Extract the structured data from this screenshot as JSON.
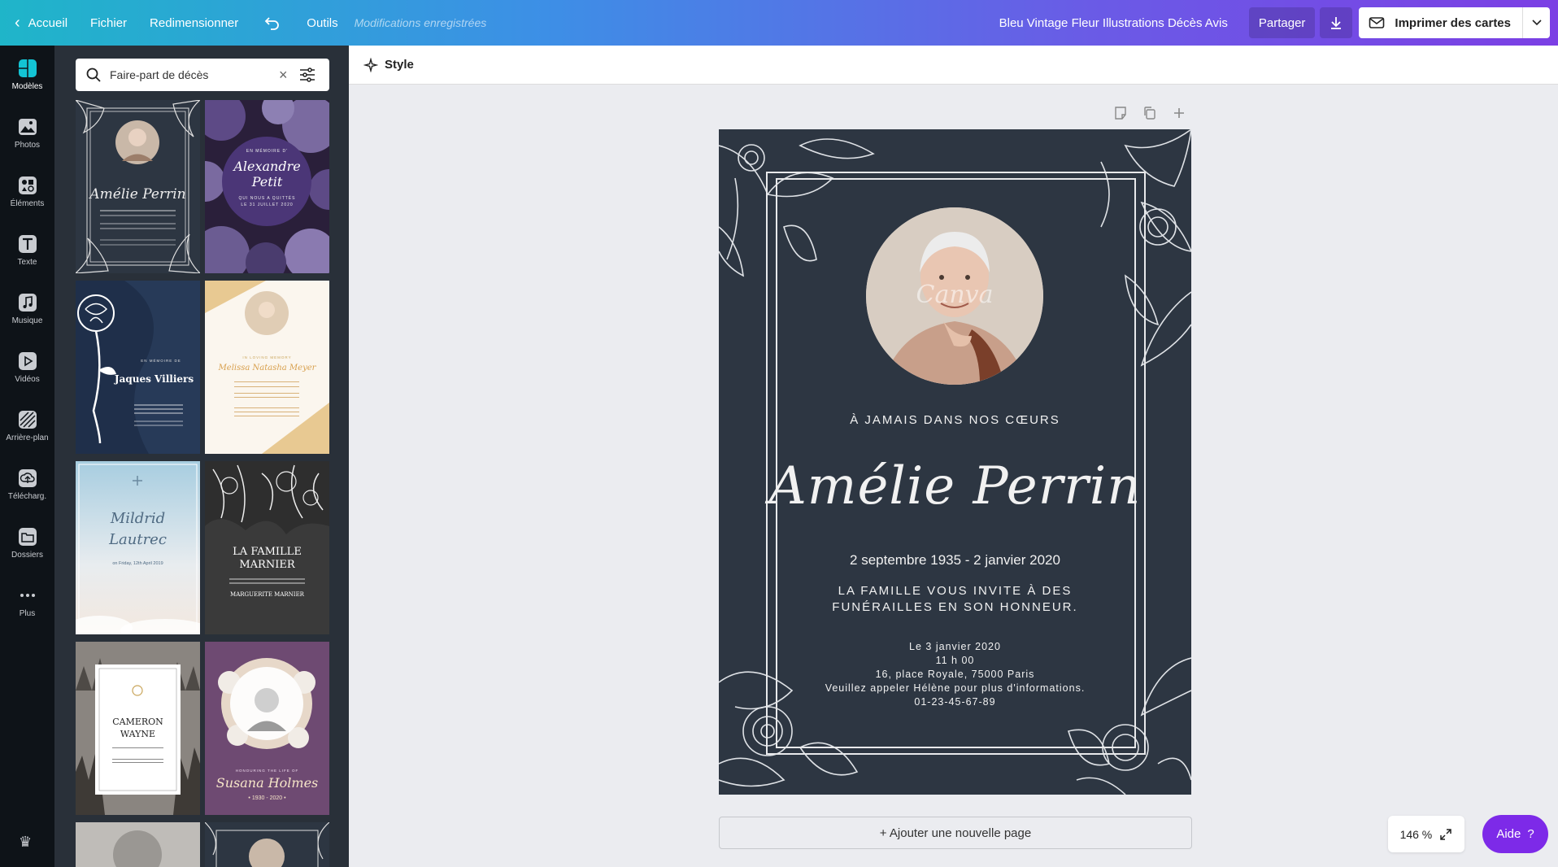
{
  "topbar": {
    "home_label": "Accueil",
    "file_label": "Fichier",
    "resize_label": "Redimensionner",
    "tools_label": "Outils",
    "saved_status": "Modifications enregistrées",
    "document_title": "Bleu Vintage Fleur Illustrations Décès Avis",
    "share_label": "Partager",
    "print_label": "Imprimer des cartes"
  },
  "rail": {
    "items": [
      {
        "label": "Modèles",
        "icon": "templates-icon"
      },
      {
        "label": "Photos",
        "icon": "photos-icon"
      },
      {
        "label": "Éléments",
        "icon": "elements-icon"
      },
      {
        "label": "Texte",
        "icon": "text-icon"
      },
      {
        "label": "Musique",
        "icon": "music-icon"
      },
      {
        "label": "Vidéos",
        "icon": "video-icon"
      },
      {
        "label": "Arrière-plan",
        "icon": "background-icon"
      },
      {
        "label": "Télécharg.",
        "icon": "upload-icon"
      },
      {
        "label": "Dossiers",
        "icon": "folder-icon"
      },
      {
        "label": "Plus",
        "icon": "more-icon"
      }
    ]
  },
  "panel": {
    "search_value": "Faire-part de décès",
    "templates": [
      {
        "lines": [
          "Amélie Perrin"
        ]
      },
      {
        "lines": [
          "EN MÉMOIRE D'",
          "Alexandre",
          "Petit",
          "QUI NOUS A QUITTÉS",
          "LE 31 JUILLET 2020"
        ]
      },
      {
        "lines": [
          "EN MÉMOIRE DE",
          "Jaques Villiers"
        ]
      },
      {
        "lines": [
          "Melissa Natasha Meyer"
        ]
      },
      {
        "lines": [
          "Mildrid",
          "Lautrec",
          "on Friday, 12th April 2019"
        ]
      },
      {
        "lines": [
          "LA FAMILLE",
          "MARNIER",
          "MARGUERITE MARNIER"
        ]
      },
      {
        "lines": [
          "CAMERON",
          "WAYNE"
        ]
      },
      {
        "lines": [
          "Susana Holmes",
          "• 1930 - 2020 •"
        ]
      }
    ]
  },
  "editor": {
    "style_label": "Style",
    "add_page_label": "+ Ajouter une nouvelle page",
    "zoom_level": "146 %",
    "help_label": "Aide",
    "help_icon": "?"
  },
  "card": {
    "watermark": "Canva",
    "caption": "À JAMAIS DANS NOS CŒURS",
    "name": "Amélie Perrin",
    "dates": "2 septembre 1935 - 2 janvier 2020",
    "invite_line1": "LA FAMILLE VOUS INVITE À DES",
    "invite_line2": "FUNÉRAILLES EN SON HONNEUR.",
    "detail_date": "Le 3 janvier 2020",
    "detail_time": "11 h 00",
    "detail_address": "16, place Royale, 75000 Paris",
    "detail_contact": "Veuillez appeler Hélène pour plus d'informations.",
    "detail_phone": "01-23-45-67-89"
  },
  "colors": {
    "accent": "#7d2ae8",
    "card_background": "#2d3642",
    "panel_background": "#293039",
    "rail_background": "#0e1318"
  }
}
